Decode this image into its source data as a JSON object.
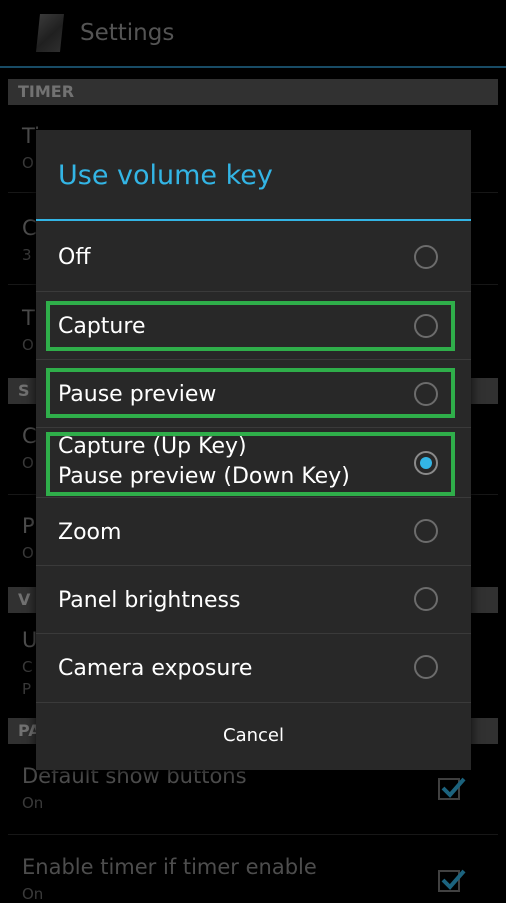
{
  "action_bar": {
    "title": "Settings"
  },
  "settings": {
    "sections": {
      "timer_header": "TIMER",
      "s_header": "S",
      "v_header": "V",
      "pa_header": "PA"
    },
    "partial_rows": [
      {
        "title": "Ti",
        "sub": "O"
      },
      {
        "title": "C",
        "sub": "3"
      },
      {
        "title": "T",
        "sub": "O"
      },
      {
        "title": "C",
        "sub": "O"
      },
      {
        "title": "P",
        "sub": "O"
      },
      {
        "title": "U",
        "sub": "C",
        "sub2": "P"
      }
    ],
    "default_show_buttons": {
      "title": "Default show buttons",
      "sub": "On",
      "checked": true
    },
    "enable_timer": {
      "title": "Enable timer if timer enable",
      "sub": "On",
      "checked": true
    }
  },
  "dialog": {
    "title": "Use volume key",
    "options": [
      {
        "label": "Off",
        "selected": false
      },
      {
        "label": "Capture",
        "selected": false
      },
      {
        "label": "Pause preview",
        "selected": false
      },
      {
        "label": "Capture (Up Key)",
        "label2": "Pause preview (Down Key)",
        "selected": true
      },
      {
        "label": "Zoom",
        "selected": false
      },
      {
        "label": "Panel brightness",
        "selected": false
      },
      {
        "label": "Camera exposure",
        "selected": false
      }
    ],
    "cancel_label": "Cancel"
  },
  "colors": {
    "accent": "#33b5e5",
    "highlight_box": "#2fae4a",
    "dialog_bg": "#282828"
  }
}
